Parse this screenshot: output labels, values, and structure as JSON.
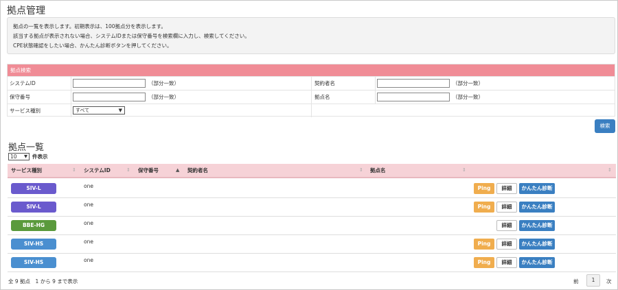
{
  "page": {
    "title": "拠点管理"
  },
  "info": {
    "lines": [
      "拠点の一覧を表示します。初期表示は、100拠点分を表示します。",
      "該当する拠点が表示されない場合、システムIDまたは保守番号を検索欄に入力し、検索してください。",
      "CPE状態確認をしたい場合、かんたん診断ボタンを押してください。"
    ]
  },
  "search": {
    "header": "拠点検索",
    "system_id_label": "システムID",
    "system_id_value": "",
    "maintenance_label": "保守番号",
    "maintenance_value": "",
    "contractor_label": "契約者名",
    "contractor_value": "",
    "site_label": "拠点名",
    "site_value": "",
    "partial_hint": "（部分一致）",
    "service_label": "サービス種別",
    "service_value": "すべて",
    "button": "検索"
  },
  "list": {
    "title": "拠点一覧",
    "page_length": "10",
    "page_length_suffix": "件表示",
    "columns": [
      "サービス種別",
      "システムID",
      "保守番号",
      "契約者名",
      "拠点名",
      ""
    ],
    "rows": [
      {
        "service": "SIV-L",
        "color": "#6a5acd",
        "system_id": "one",
        "ping": true
      },
      {
        "service": "SIV-L",
        "color": "#6a5acd",
        "system_id": "one",
        "ping": true
      },
      {
        "service": "BBE-HG",
        "color": "#5a9a3c",
        "system_id": "one",
        "ping": false
      },
      {
        "service": "SIV-HS",
        "color": "#4a8fd0",
        "system_id": "one",
        "ping": true
      },
      {
        "service": "SIV-HS",
        "color": "#4a8fd0",
        "system_id": "one",
        "ping": true
      }
    ],
    "ping_label": "Ping",
    "detail_label": "詳細",
    "diag_label": "かんたん診断",
    "summary": "全 9 拠点　1 から 9 まで表示",
    "pager": {
      "prev": "前",
      "current": "1",
      "next": "次"
    }
  }
}
